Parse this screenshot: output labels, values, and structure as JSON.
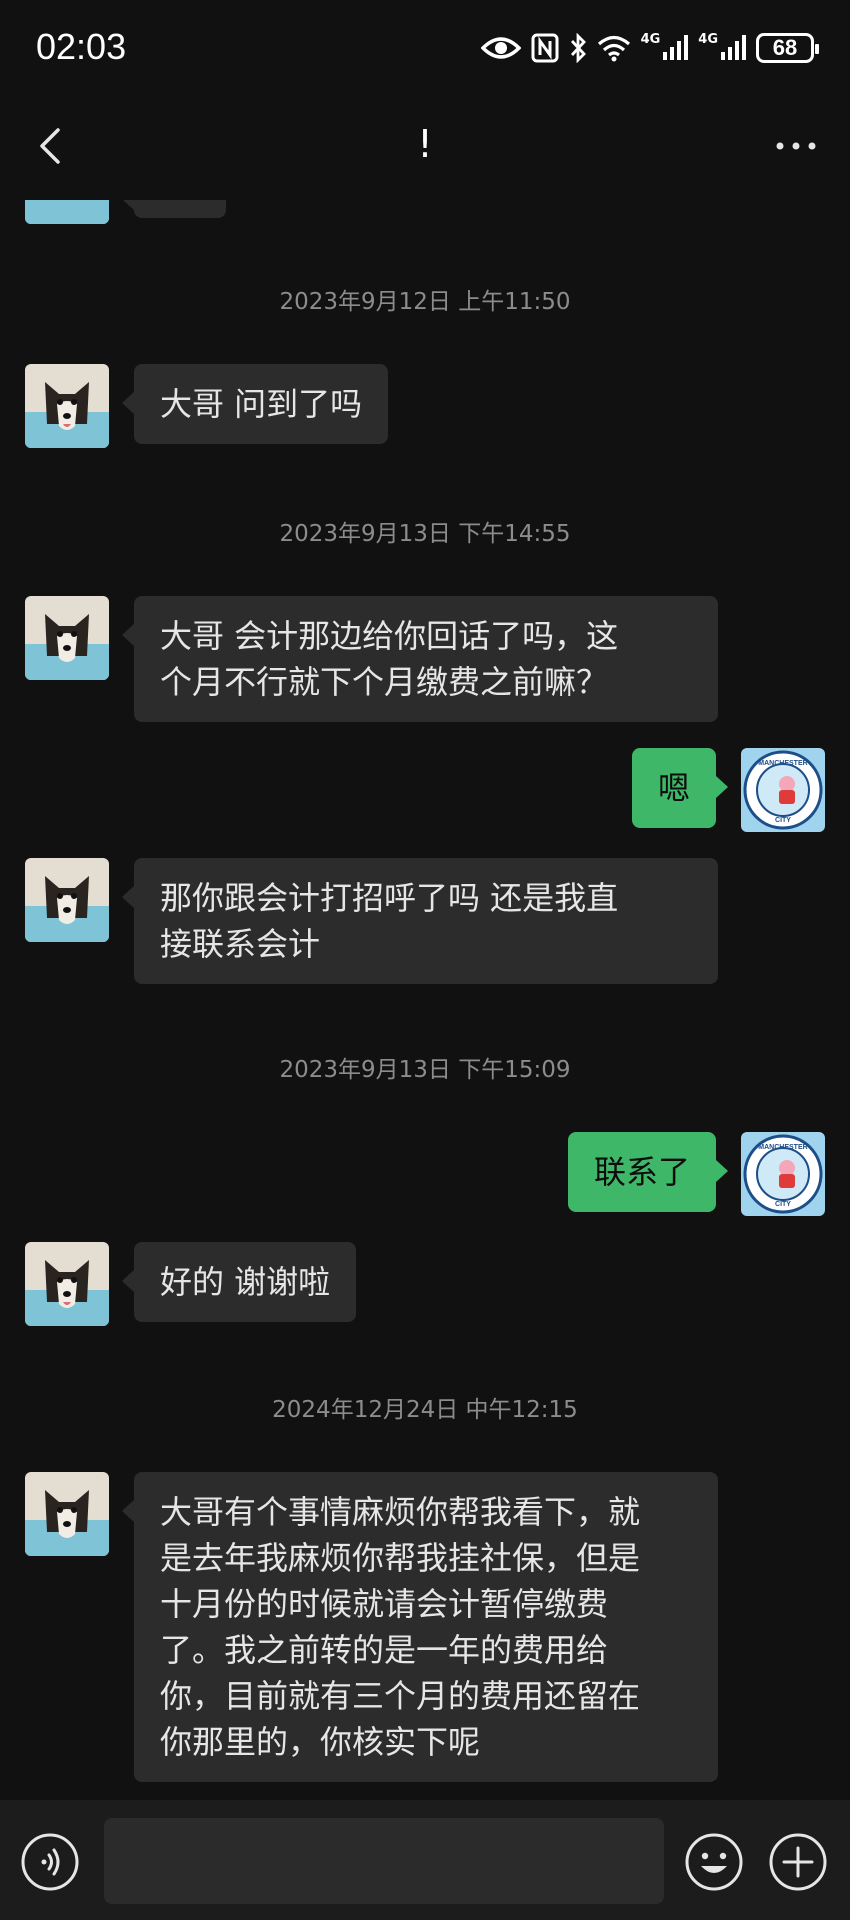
{
  "status_bar": {
    "time": "02:03",
    "signal_1_label": "4G",
    "signal_2_label": "4G",
    "battery": "68"
  },
  "header": {
    "title": "!"
  },
  "icons": {
    "back": "chevron-left-icon",
    "more": "more-dots-icon",
    "voice": "voice-icon",
    "emoji": "emoji-icon",
    "plus": "plus-icon"
  },
  "colors": {
    "background": "#111111",
    "incoming_bubble": "#2c2c2c",
    "outgoing_bubble": "#3fb768",
    "timestamp": "#8c8c8c"
  },
  "chat": {
    "timestamps": [
      "2023年9月12日 上午11:50",
      "2023年9月13日 下午14:55",
      "2023年9月13日 下午15:09",
      "2024年12月24日 中午12:15"
    ],
    "messages": [
      {
        "direction": "incoming",
        "lines": [
          "大哥 问到了吗"
        ]
      },
      {
        "direction": "incoming",
        "lines": [
          "大哥 会计那边给你回话了吗，这",
          "个月不行就下个月缴费之前嘛？"
        ]
      },
      {
        "direction": "outgoing",
        "lines": [
          "嗯"
        ]
      },
      {
        "direction": "incoming",
        "lines": [
          "那你跟会计打招呼了吗 还是我直",
          "接联系会计"
        ]
      },
      {
        "direction": "outgoing",
        "lines": [
          "联系了"
        ]
      },
      {
        "direction": "incoming",
        "lines": [
          "好的 谢谢啦"
        ]
      },
      {
        "direction": "incoming",
        "lines": [
          "大哥有个事情麻烦你帮我看下，就",
          "是去年我麻烦你帮我挂社保，但是",
          "十月份的时候就请会计暂停缴费",
          "了。我之前转的是一年的费用给",
          "你，目前就有三个月的费用还留在",
          "你那里的，你核实下呢"
        ]
      }
    ],
    "outgoing_avatar_text": {
      "top": "MANCHESTER",
      "bottom": "CITY"
    }
  },
  "input_bar": {
    "placeholder": ""
  }
}
